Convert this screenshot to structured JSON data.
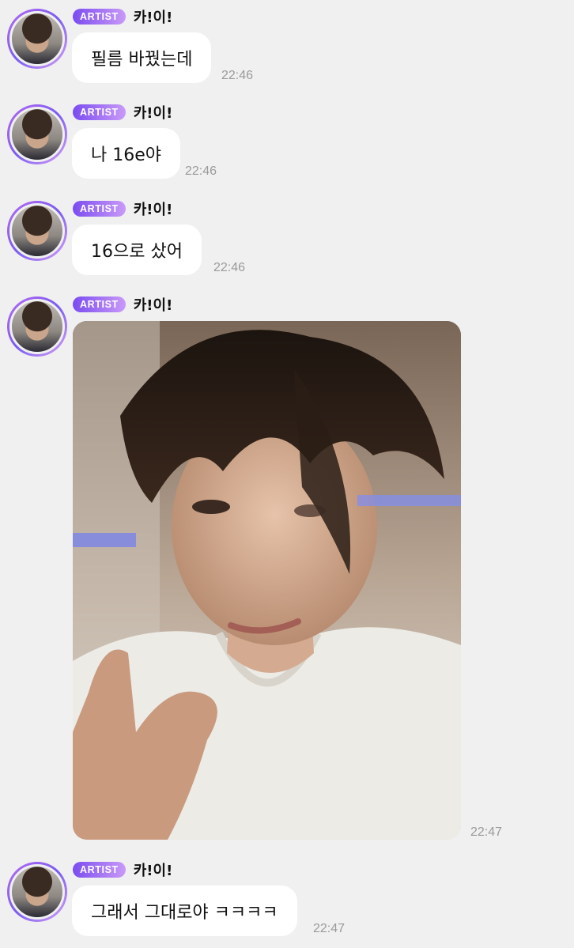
{
  "sender": {
    "badge": "ARTIST",
    "name": "카!이!"
  },
  "messages": [
    {
      "type": "text",
      "text": "필름 바꿨는데",
      "time": "22:46"
    },
    {
      "type": "text",
      "text": "나 16e야",
      "time": "22:46"
    },
    {
      "type": "text",
      "text": "16으로 샀어",
      "time": "22:46"
    },
    {
      "type": "image",
      "time": "22:47"
    },
    {
      "type": "text",
      "text": "그래서 그대로야 ㅋㅋㅋㅋ",
      "time": "22:47"
    }
  ],
  "colors": {
    "background": "#f0f0f0",
    "bubble": "#ffffff",
    "badge_start": "#7b4cf0",
    "badge_end": "#c99af8",
    "timestamp": "#9a9a9a"
  }
}
